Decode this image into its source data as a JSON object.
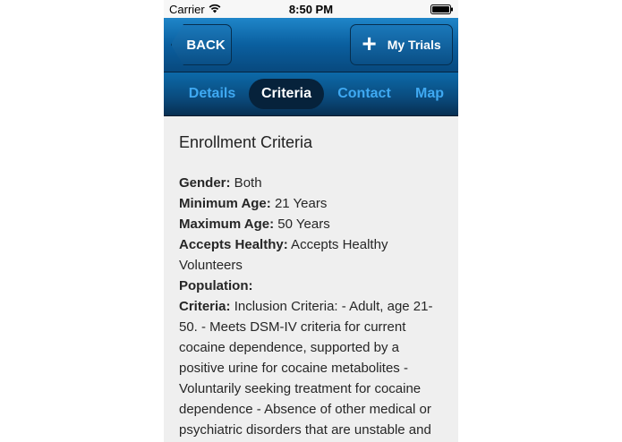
{
  "status_bar": {
    "carrier": "Carrier",
    "time": "8:50 PM"
  },
  "navbar": {
    "back_label": "BACK",
    "my_trials_label": "My Trials"
  },
  "tabs": [
    {
      "label": "Details",
      "active": false
    },
    {
      "label": "Criteria",
      "active": true
    },
    {
      "label": "Contact",
      "active": false
    },
    {
      "label": "Map",
      "active": false
    }
  ],
  "content": {
    "title": "Enrollment Criteria",
    "fields": [
      {
        "label": "Gender:",
        "value": " Both"
      },
      {
        "label": "Minimum Age:",
        "value": " 21 Years"
      },
      {
        "label": "Maximum Age:",
        "value": " 50 Years"
      },
      {
        "label": "Accepts Healthy:",
        "value": " Accepts Healthy Volunteers"
      },
      {
        "label": "Population:",
        "value": ""
      },
      {
        "label": "Criteria:",
        "value": " Inclusion Criteria: - Adult, age 21-50. - Meets DSM-IV criteria for current cocaine dependence, supported by a positive urine for cocaine metabolites - Voluntarily seeking treatment for cocaine dependence - Absence of other medical or psychiatric disorders that are unstable and could interfere with participation"
      }
    ]
  },
  "colors": {
    "nav_blue": "#0a5f9f",
    "tab_text": "#3fa9f2",
    "tab_active_bg": "#06223b",
    "content_bg": "#efefef"
  }
}
